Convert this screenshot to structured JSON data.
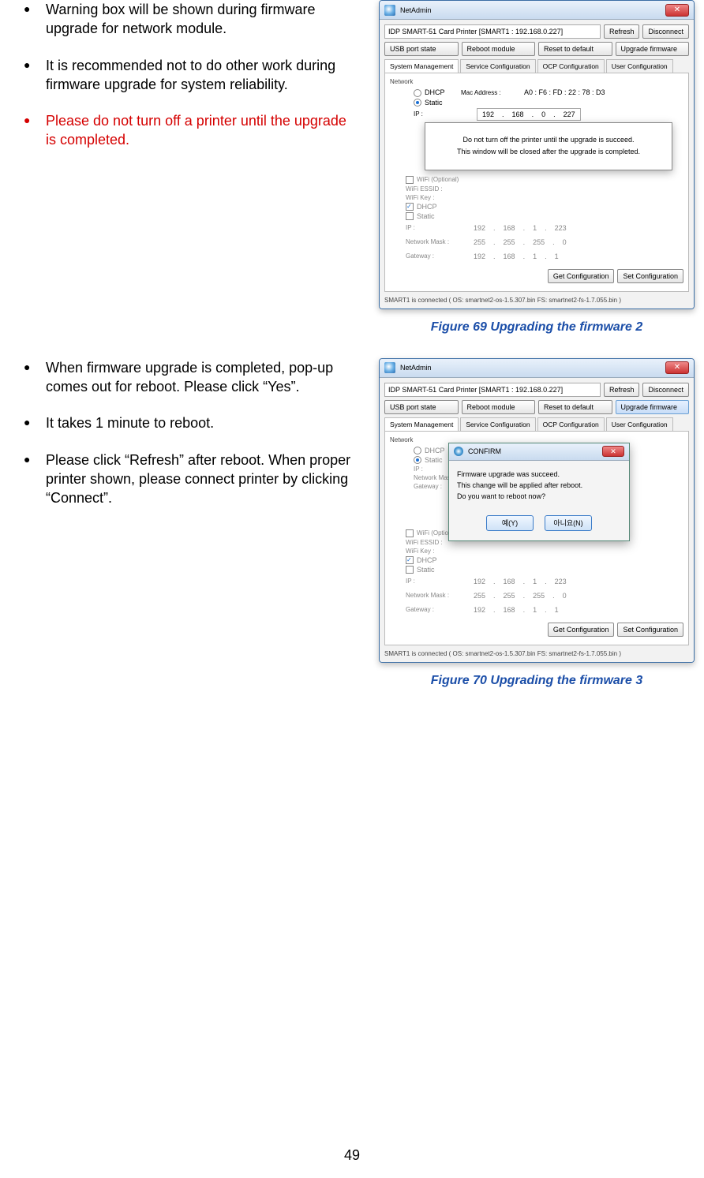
{
  "section1": {
    "bullets": [
      "Warning box will be shown during firmware upgrade for network module.",
      "It is recommended not to do other work during firmware upgrade for system reliability.",
      "Please do not turn off a printer until the upgrade is completed."
    ]
  },
  "section2": {
    "bullets": [
      "When firmware upgrade is completed, pop-up comes out for reboot. Please click “Yes”.",
      "It takes 1 minute to reboot.",
      "Please click “Refresh” after reboot. When proper printer shown, please connect printer by clicking “Connect”."
    ]
  },
  "netadmin": {
    "title": "NetAdmin",
    "device": "IDP SMART-51 Card Printer  [SMART1 : 192.168.0.227]",
    "btn_refresh": "Refresh",
    "btn_disconnect": "Disconnect",
    "btn_usb": "USB port state",
    "btn_reboot": "Reboot module",
    "btn_reset": "Reset to default",
    "btn_upgrade": "Upgrade firmware",
    "tabs": [
      "System Management",
      "Service Configuration",
      "OCP Configuration",
      "User Configuration"
    ],
    "network_label": "Network",
    "dhcp": "DHCP",
    "static": "Static",
    "mac_label": "Mac Address :",
    "mac_value": "A0 : F6 : FD : 22 : 78 : D3",
    "ip_label": "IP :",
    "ip1": [
      "192",
      "168",
      "0",
      "227"
    ],
    "netmask_label": "Network Mask :",
    "gateway_label": "Gateway :",
    "wifi_label": "WiFi (Optional)",
    "wifi_essid": "WiFi ESSID :",
    "wifi_key": "WiFi Key :",
    "ip2": [
      "192",
      "168",
      "1",
      "223"
    ],
    "mask2": [
      "255",
      "255",
      "255",
      "0"
    ],
    "gw2": [
      "192",
      "168",
      "1",
      "1"
    ],
    "btn_get": "Get Configuration",
    "btn_set": "Set Configuration",
    "status": "SMART1 is connected ( OS: smartnet2-os-1.5.307.bin  FS: smartnet2-fs-1.7.055.bin )"
  },
  "overlay1": {
    "line1": "Do not turn off the printer until the upgrade is succeed.",
    "line2": "This window will be closed after the upgrade is completed."
  },
  "confirm": {
    "title": "CONFIRM",
    "line1": "Firmware upgrade was succeed.",
    "line2": "This change will be applied after reboot.",
    "line3": "Do you want to reboot now?",
    "yes": "예(Y)",
    "no": "아니요(N)"
  },
  "captions": {
    "fig69": "Figure 69 Upgrading the firmware 2",
    "fig70": "Figure 70 Upgrading the firmware 3"
  },
  "page_number": "49"
}
